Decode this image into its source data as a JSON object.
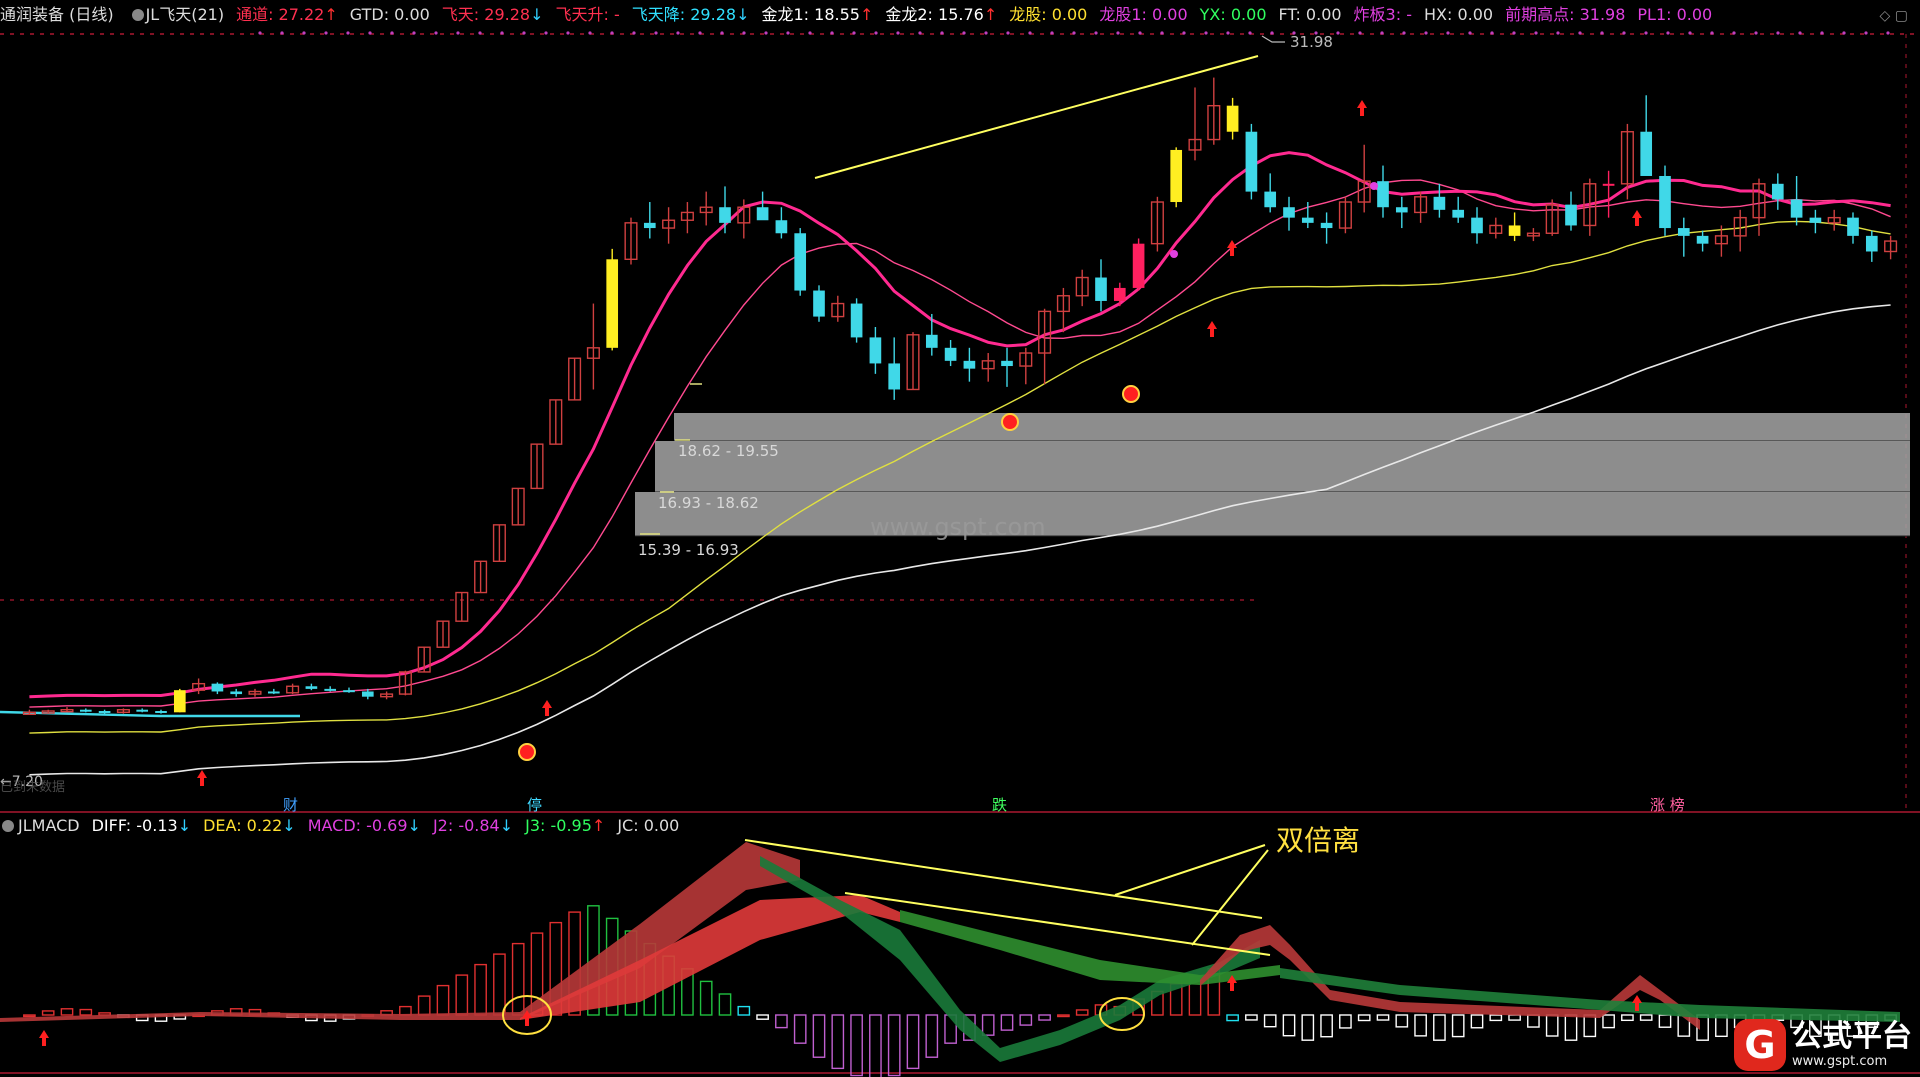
{
  "header": {
    "title": "通润装备 (日线)",
    "indicator": "JL飞天(21)",
    "values": [
      {
        "label": "通道:",
        "value": "27.22",
        "color": "#ff3050",
        "arrow": "up"
      },
      {
        "label": "GTD:",
        "value": "0.00",
        "color": "#dddddd",
        "arrow": ""
      },
      {
        "label": "飞天:",
        "value": "29.28",
        "color": "#ff3050",
        "arrow": "down"
      },
      {
        "label": "飞天升:",
        "value": "-",
        "color": "#ff3050",
        "arrow": ""
      },
      {
        "label": "飞天降:",
        "value": "29.28",
        "color": "#30e0ff",
        "arrow": "down"
      },
      {
        "label": "金龙1:",
        "value": "18.55",
        "color": "#ffffff",
        "arrow": "up"
      },
      {
        "label": "金龙2:",
        "value": "15.76",
        "color": "#ffffff",
        "arrow": "up"
      },
      {
        "label": "龙股:",
        "value": "0.00",
        "color": "#ffe030",
        "arrow": ""
      },
      {
        "label": "龙股1:",
        "value": "0.00",
        "color": "#e040e0",
        "arrow": ""
      },
      {
        "label": "YX:",
        "value": "0.00",
        "color": "#30ff60",
        "arrow": ""
      },
      {
        "label": "FT:",
        "value": "0.00",
        "color": "#dddddd",
        "arrow": ""
      },
      {
        "label": "炸板3:",
        "value": "-",
        "color": "#e040e0",
        "arrow": ""
      },
      {
        "label": "HX:",
        "value": "0.00",
        "color": "#dddddd",
        "arrow": ""
      },
      {
        "label": "前期高点:",
        "value": "31.98",
        "color": "#e040e0",
        "arrow": ""
      },
      {
        "label": "PL1:",
        "value": "0.00",
        "color": "#e040e0",
        "arrow": ""
      }
    ]
  },
  "macd_header": {
    "title": "JLMACD",
    "values": [
      {
        "label": "DIFF:",
        "value": "-0.13",
        "color": "#ffffff",
        "arrow": "down"
      },
      {
        "label": "DEA:",
        "value": "0.22",
        "color": "#ffe030",
        "arrow": "down"
      },
      {
        "label": "MACD:",
        "value": "-0.69",
        "color": "#e040e0",
        "arrow": "down"
      },
      {
        "label": "J2:",
        "value": "-0.84",
        "color": "#e040e0",
        "arrow": "down"
      },
      {
        "label": "J3:",
        "value": "-0.95",
        "color": "#30ff60",
        "arrow": "up"
      },
      {
        "label": "JC:",
        "value": "0.00",
        "color": "#dddddd",
        "arrow": ""
      }
    ]
  },
  "chart_data": {
    "type": "candlestick",
    "high_label": "31.98",
    "low_label": "7.20",
    "no_data_label": "已到末数据",
    "zones": [
      {
        "label": "18.62 - 19.55"
      },
      {
        "label": "16.93 - 18.62"
      },
      {
        "label": "15.39 - 16.93"
      }
    ],
    "bottom_markers": [
      "财",
      "停",
      "跌",
      "涨 榜"
    ],
    "annotation": "双倍离",
    "watermark": "www.gspt.com",
    "candles": [
      [
        7.6,
        7.7,
        7.5,
        7.6
      ],
      [
        7.6,
        7.7,
        7.55,
        7.65
      ],
      [
        7.65,
        7.8,
        7.6,
        7.7
      ],
      [
        7.7,
        7.75,
        7.6,
        7.65
      ],
      [
        7.65,
        7.7,
        7.55,
        7.6
      ],
      [
        7.6,
        7.75,
        7.55,
        7.7
      ],
      [
        7.7,
        7.75,
        7.6,
        7.65
      ],
      [
        7.65,
        7.7,
        7.55,
        7.6
      ],
      [
        7.6,
        8.5,
        7.6,
        8.45
      ],
      [
        8.45,
        8.9,
        8.3,
        8.7
      ],
      [
        8.7,
        8.75,
        8.3,
        8.4
      ],
      [
        8.4,
        8.5,
        8.2,
        8.3
      ],
      [
        8.3,
        8.5,
        8.2,
        8.4
      ],
      [
        8.4,
        8.5,
        8.3,
        8.35
      ],
      [
        8.35,
        8.7,
        8.3,
        8.6
      ],
      [
        8.6,
        8.7,
        8.45,
        8.5
      ],
      [
        8.5,
        8.6,
        8.4,
        8.45
      ],
      [
        8.45,
        8.55,
        8.35,
        8.4
      ],
      [
        8.4,
        8.5,
        8.1,
        8.2
      ],
      [
        8.2,
        8.4,
        8.1,
        8.3
      ],
      [
        8.3,
        9.2,
        8.25,
        9.15
      ],
      [
        9.15,
        10.1,
        9.15,
        10.1
      ],
      [
        10.1,
        11.1,
        10.1,
        11.1
      ],
      [
        11.1,
        12.2,
        11.1,
        12.2
      ],
      [
        12.2,
        13.4,
        12.2,
        13.4
      ],
      [
        13.4,
        14.8,
        13.4,
        14.8
      ],
      [
        14.8,
        16.2,
        14.8,
        16.2
      ],
      [
        16.2,
        17.9,
        16.2,
        17.9
      ],
      [
        17.9,
        19.6,
        17.9,
        19.6
      ],
      [
        19.6,
        21.2,
        19.6,
        21.2
      ],
      [
        21.2,
        23.3,
        20.0,
        21.6
      ],
      [
        21.6,
        25.4,
        21.5,
        25.0
      ],
      [
        25.0,
        26.6,
        24.8,
        26.4
      ],
      [
        26.4,
        27.2,
        25.8,
        26.2
      ],
      [
        26.2,
        27.0,
        25.6,
        26.5
      ],
      [
        26.5,
        27.2,
        26.0,
        26.8
      ],
      [
        26.8,
        27.6,
        26.3,
        27.0
      ],
      [
        27.0,
        27.8,
        26.0,
        26.4
      ],
      [
        26.4,
        27.3,
        25.8,
        27.0
      ],
      [
        27.0,
        27.6,
        26.6,
        26.5
      ],
      [
        26.5,
        27.0,
        25.8,
        26.0
      ],
      [
        26.0,
        26.2,
        23.6,
        23.8
      ],
      [
        23.8,
        24.0,
        22.6,
        22.8
      ],
      [
        22.8,
        23.6,
        22.6,
        23.3
      ],
      [
        23.3,
        23.5,
        21.8,
        22.0
      ],
      [
        22.0,
        22.4,
        20.6,
        21.0
      ],
      [
        21.0,
        22.0,
        19.6,
        20.0
      ],
      [
        20.0,
        22.2,
        20.0,
        22.1
      ],
      [
        22.1,
        22.9,
        21.3,
        21.6
      ],
      [
        21.6,
        21.9,
        20.9,
        21.1
      ],
      [
        21.1,
        21.6,
        20.3,
        20.8
      ],
      [
        20.8,
        21.4,
        20.3,
        21.1
      ],
      [
        21.1,
        21.6,
        20.1,
        20.9
      ],
      [
        20.9,
        21.6,
        20.2,
        21.4
      ],
      [
        21.4,
        23.1,
        20.2,
        23.0
      ],
      [
        23.0,
        23.9,
        22.2,
        23.6
      ],
      [
        23.6,
        24.6,
        23.2,
        24.3
      ],
      [
        24.3,
        25.0,
        23.0,
        23.4
      ],
      [
        23.4,
        24.1,
        23.2,
        23.9
      ],
      [
        23.9,
        25.8,
        23.8,
        25.6
      ],
      [
        25.6,
        27.4,
        25.3,
        27.2
      ],
      [
        27.2,
        29.3,
        27.0,
        29.2
      ],
      [
        29.2,
        31.6,
        28.8,
        29.6
      ],
      [
        29.6,
        31.98,
        29.4,
        30.9
      ],
      [
        30.9,
        31.2,
        29.6,
        29.9
      ],
      [
        29.9,
        30.2,
        27.3,
        27.6
      ],
      [
        27.6,
        28.3,
        26.8,
        27.0
      ],
      [
        27.0,
        27.4,
        26.1,
        26.6
      ],
      [
        26.6,
        27.2,
        26.2,
        26.4
      ],
      [
        26.4,
        26.8,
        25.6,
        26.2
      ],
      [
        26.2,
        27.4,
        26.0,
        27.2
      ],
      [
        27.2,
        29.4,
        26.8,
        28.0
      ],
      [
        28.0,
        28.6,
        26.6,
        27.0
      ],
      [
        27.0,
        27.4,
        26.2,
        26.8
      ],
      [
        26.8,
        27.6,
        26.4,
        27.4
      ],
      [
        27.4,
        27.9,
        26.6,
        26.9
      ],
      [
        26.9,
        27.4,
        26.4,
        26.6
      ],
      [
        26.6,
        27.0,
        25.6,
        26.0
      ],
      [
        26.0,
        26.6,
        25.8,
        26.3
      ],
      [
        26.3,
        26.8,
        25.7,
        25.9
      ],
      [
        25.9,
        26.2,
        25.7,
        26.0
      ],
      [
        26.0,
        27.3,
        25.9,
        27.1
      ],
      [
        27.1,
        27.6,
        26.1,
        26.3
      ],
      [
        26.3,
        28.1,
        25.9,
        27.9
      ],
      [
        27.9,
        28.4,
        26.6,
        27.9
      ],
      [
        27.9,
        30.2,
        27.3,
        29.9
      ],
      [
        29.9,
        31.3,
        29.6,
        28.2
      ],
      [
        28.2,
        28.6,
        25.9,
        26.2
      ],
      [
        26.2,
        26.6,
        25.1,
        25.9
      ],
      [
        25.9,
        26.1,
        25.3,
        25.6
      ],
      [
        25.6,
        26.3,
        25.1,
        25.9
      ],
      [
        25.9,
        26.9,
        25.3,
        26.6
      ],
      [
        26.6,
        28.1,
        25.9,
        27.9
      ],
      [
        27.9,
        28.3,
        26.9,
        27.3
      ],
      [
        27.3,
        28.2,
        26.3,
        26.6
      ],
      [
        26.6,
        26.9,
        26.0,
        26.4
      ],
      [
        26.4,
        26.9,
        26.1,
        26.6
      ],
      [
        26.6,
        26.8,
        25.6,
        25.9
      ],
      [
        25.9,
        26.1,
        24.9,
        25.3
      ],
      [
        25.3,
        25.9,
        25.0,
        25.7
      ]
    ],
    "up_color": "#d04040",
    "down_color": "#40d8e8",
    "highlight_color": "#ffee22",
    "limit_color": "#ff2060",
    "line_color_fast": "#ff2a90",
    "line_color_fast2": "#40d8e8",
    "line_color_slow": "#ff4a90",
    "line_color_yellow": "#e0e040",
    "line_color_white": "#e8e8e8"
  }
}
